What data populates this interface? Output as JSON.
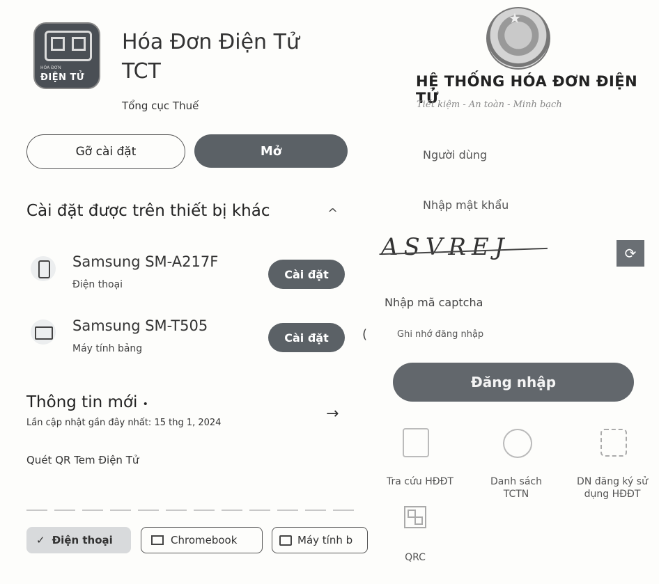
{
  "store": {
    "app": {
      "icon_small_text": "HÓA ĐƠN",
      "icon_big_text": "ĐIỆN TỬ",
      "title": "Hóa Đơn Điện Tử TCT",
      "developer": "Tổng cục Thuế"
    },
    "buttons": {
      "uninstall": "Gỡ cài đặt",
      "open": "Mở"
    },
    "other_devices": {
      "title": "Cài đặt được trên thiết bị khác",
      "caret": "^",
      "devices": [
        {
          "name": "Samsung SM-A217F",
          "type": "Điện thoại",
          "button": "Cài đặt",
          "icon": "phone-icon"
        },
        {
          "name": "Samsung SM-T505",
          "type": "Máy tính bảng",
          "button": "Cài đặt",
          "icon": "tablet-icon"
        }
      ],
      "edge_glyph": "("
    },
    "whats_new": {
      "title": "Thông tin mới",
      "dot": "•",
      "updated": "Lần cập nhật gần đây nhất: 15 thg 1, 2024",
      "arrow": "→",
      "body": "Quét QR Tem Điện Tử"
    },
    "chips": [
      {
        "label": "Điện thoại",
        "check": "✓",
        "selected": true
      },
      {
        "label": "Chromebook",
        "selected": false
      },
      {
        "label": "Máy tính b",
        "selected": false
      }
    ]
  },
  "login_screen": {
    "emblem_text": "",
    "system_title": "HỆ THỐNG HÓA ĐƠN ĐIỆN TỬ",
    "slogan": "Tiết kiệm - An toàn - Minh bạch",
    "username_placeholder": "Người dùng",
    "password_placeholder": "Nhập mật khẩu",
    "captcha_text": "ASVREJ",
    "refresh_icon": "⟳",
    "captcha_placeholder": "Nhập mã captcha",
    "remember_label": "Ghi nhớ đăng nhập",
    "login_button": "Đăng nhập",
    "tiles": [
      {
        "label": "Tra cứu HĐĐT",
        "icon": "document-search-icon"
      },
      {
        "label": "Danh sách TCTN",
        "icon": "emblem-icon"
      },
      {
        "label": "DN đăng ký sử dụng HĐĐT",
        "icon": "face-scan-icon"
      },
      {
        "label": "QRC",
        "icon": "qr-code-icon"
      }
    ]
  },
  "colors": {
    "dark_button": "#5b6166",
    "background": "#fdfdfb"
  }
}
